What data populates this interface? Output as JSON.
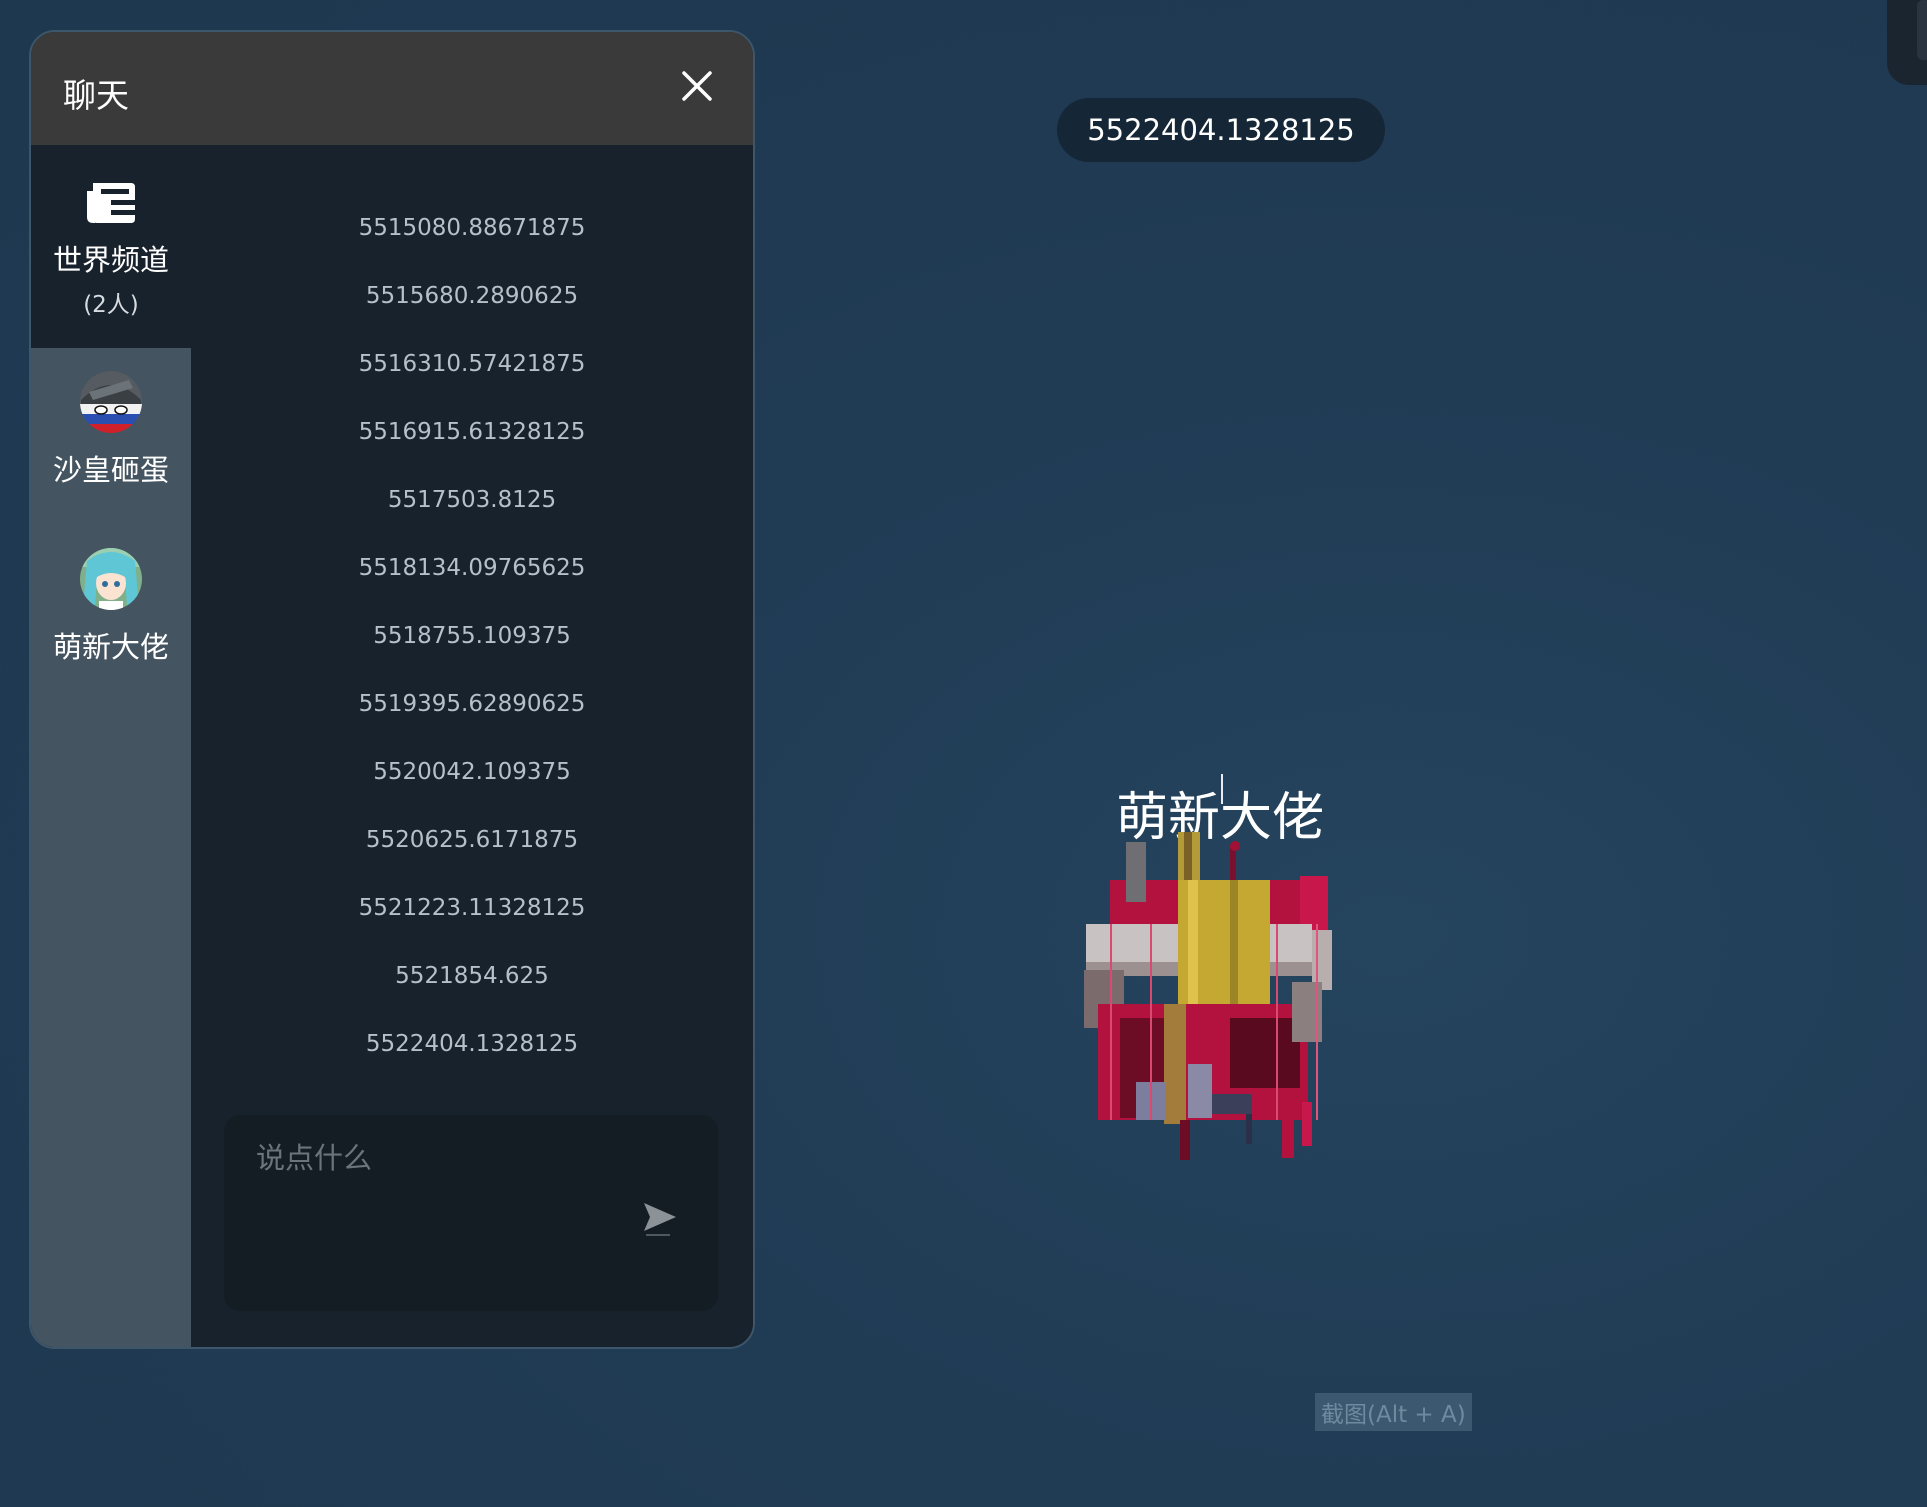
{
  "chat": {
    "title": "聊天",
    "channels": [
      {
        "name": "世界频道",
        "count": "(2人)",
        "icon": "world-channel-icon"
      },
      {
        "name": "沙皇砸蛋",
        "icon": "avatar-countryball"
      },
      {
        "name": "萌新大佬",
        "icon": "avatar-anime-girl"
      }
    ],
    "messages": [
      "5515080.88671875",
      "5515680.2890625",
      "5516310.57421875",
      "5516915.61328125",
      "5517503.8125",
      "5518134.09765625",
      "5518755.109375",
      "5519395.62890625",
      "5520042.109375",
      "5520625.6171875",
      "5521223.11328125",
      "5521854.625",
      "5522404.1328125"
    ],
    "input_placeholder": "说点什么",
    "input_value": ""
  },
  "game": {
    "score": "5522404.1328125",
    "player_name": "萌新大佬"
  },
  "hint": "截图(Alt + A)",
  "colors": {
    "background": "#1f3a52",
    "panel": "#18222c",
    "header": "#3a3a3a",
    "sidebar": "#445461",
    "score_pill": "#152736"
  }
}
